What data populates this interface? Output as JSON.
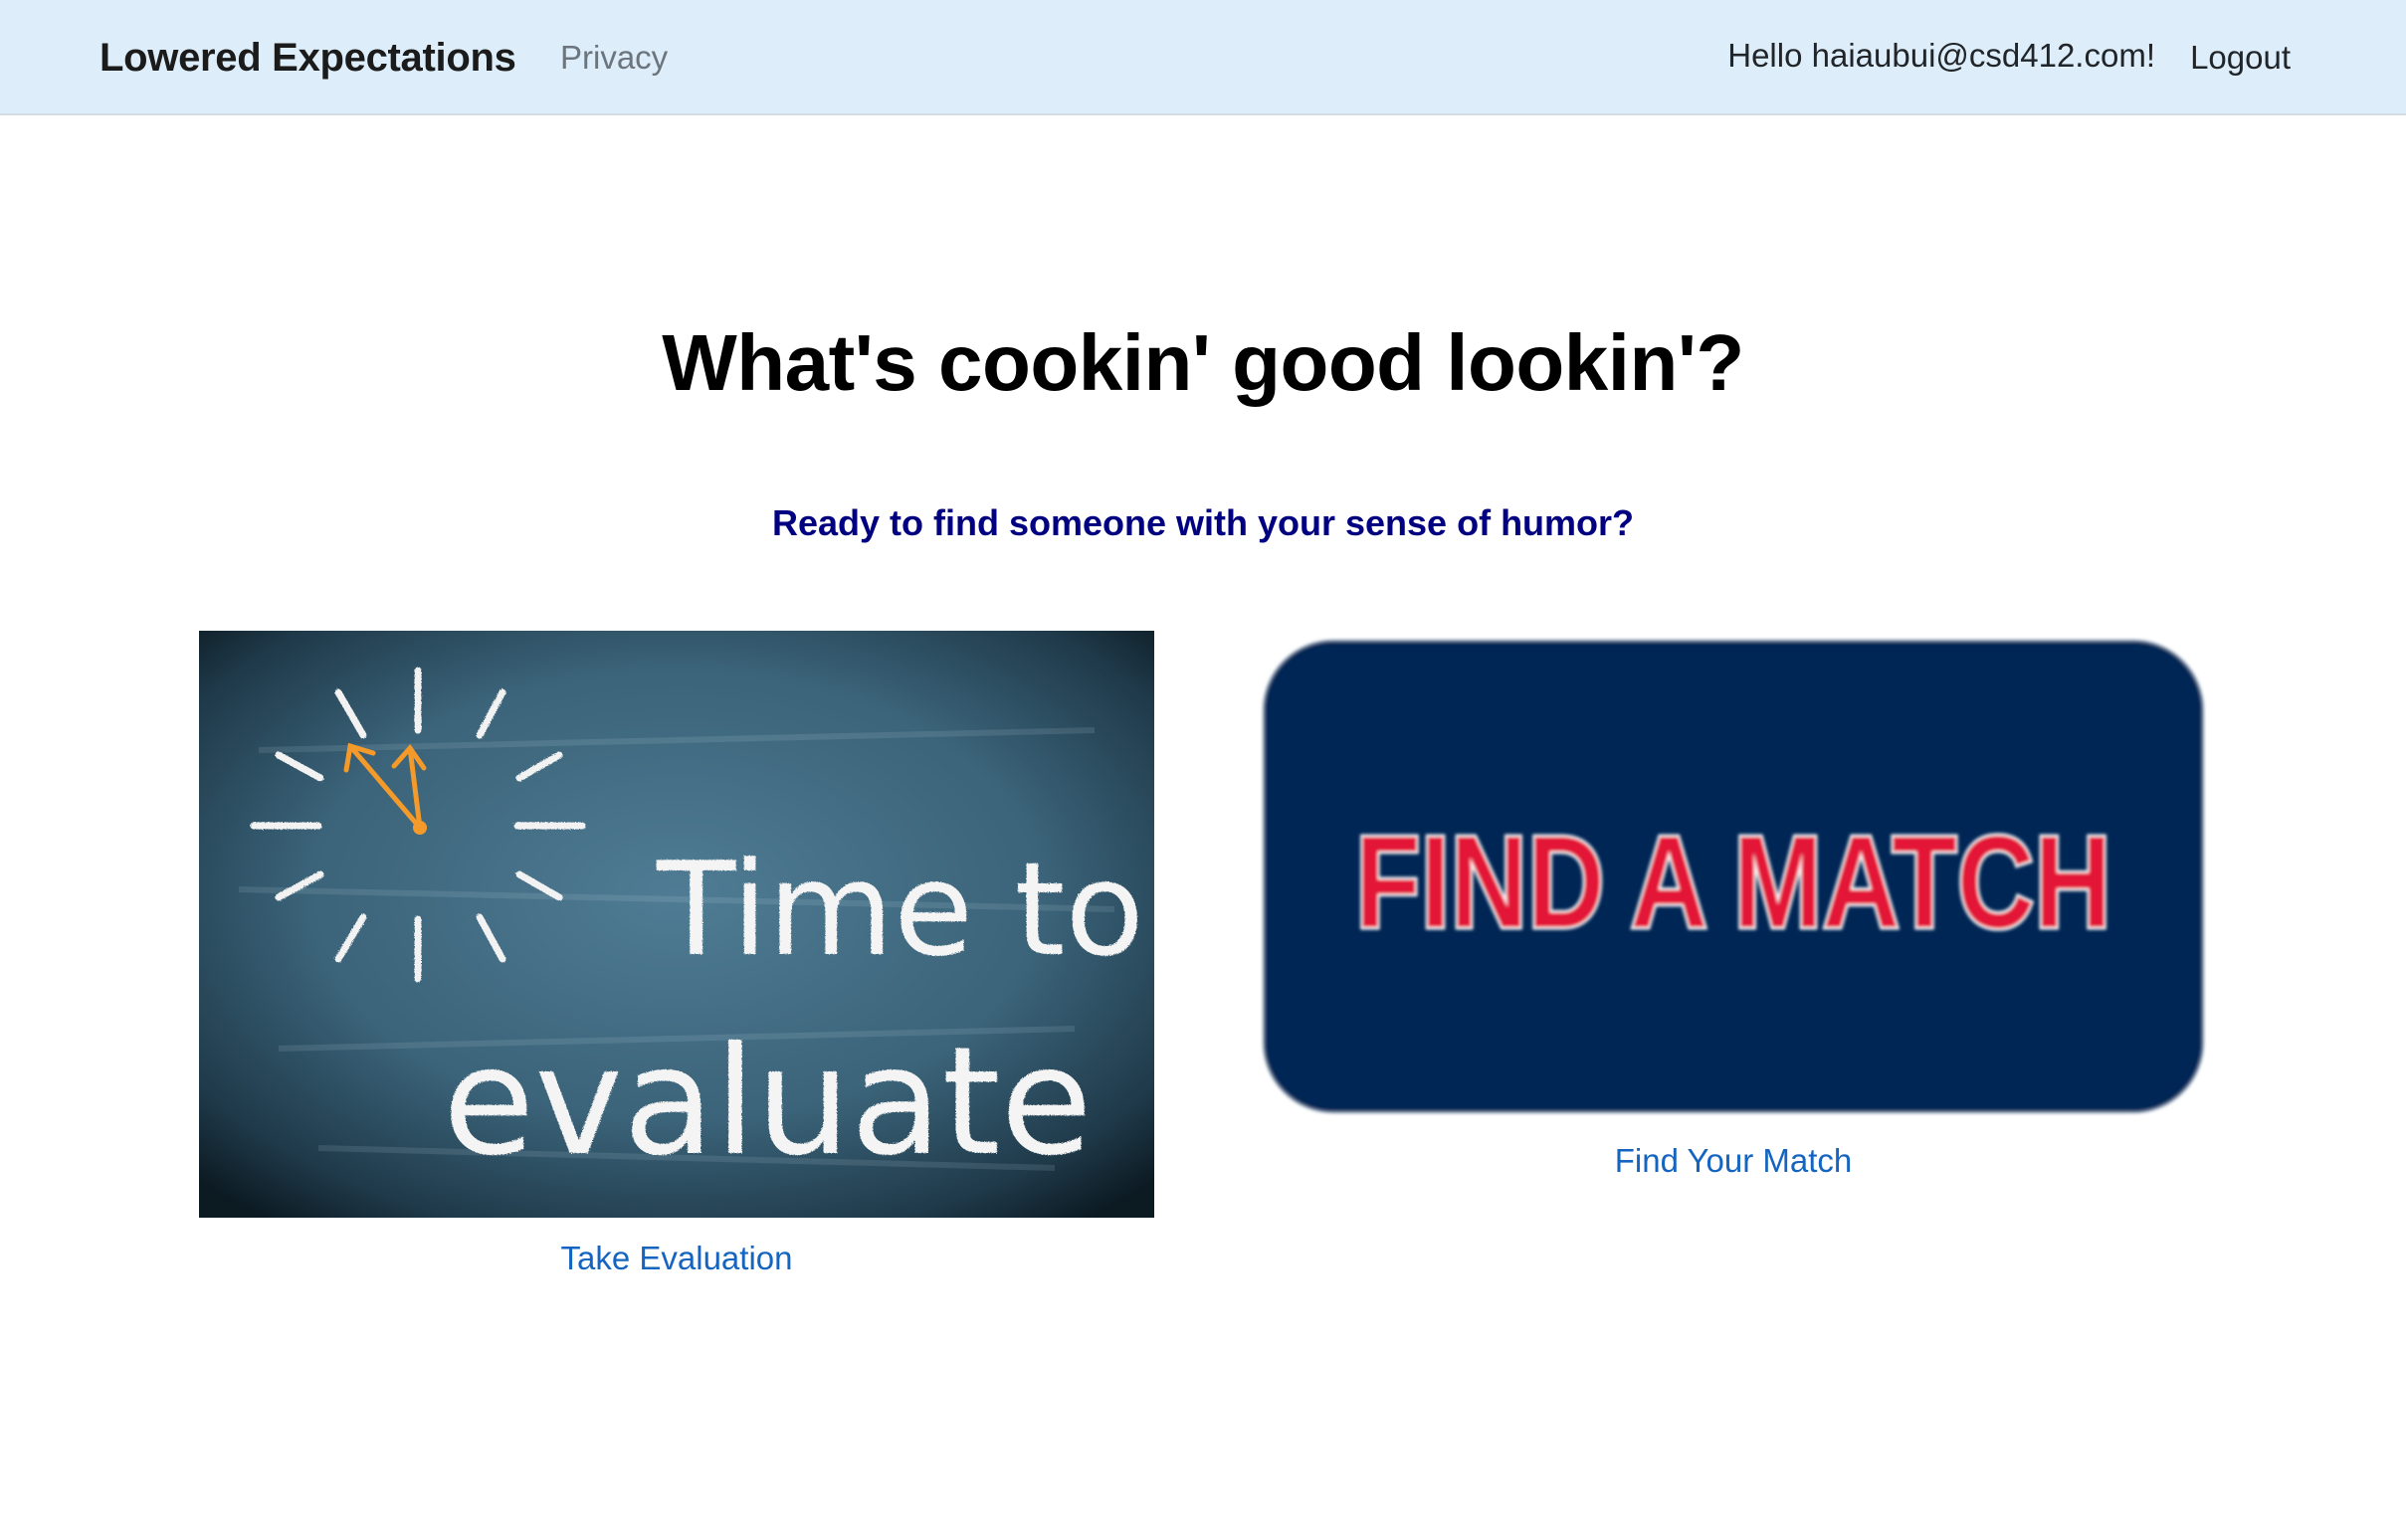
{
  "navbar": {
    "brand": "Lowered Expectations",
    "links": [
      {
        "label": "Privacy"
      }
    ],
    "greeting": "Hello haiaubui@csd412.com!",
    "logout_label": "Logout",
    "background": "#ddeefa"
  },
  "hero": {
    "title": "What's cookin' good lookin'?",
    "subtitle": "Ready to find someone with your sense of humor?",
    "subtitle_color": "#000080"
  },
  "cards": [
    {
      "image": {
        "name": "time-to-evaluate-image",
        "text_line1": "Time to",
        "text_line2": "evaluate"
      },
      "link_label": "Take Evaluation"
    },
    {
      "image": {
        "name": "find-a-match-image",
        "text": "FIND A MATCH",
        "background": "#002654",
        "text_color": "#e31837"
      },
      "link_label": "Find Your Match"
    }
  ],
  "colors": {
    "link": "#1565c0",
    "muted": "#6c757d"
  }
}
